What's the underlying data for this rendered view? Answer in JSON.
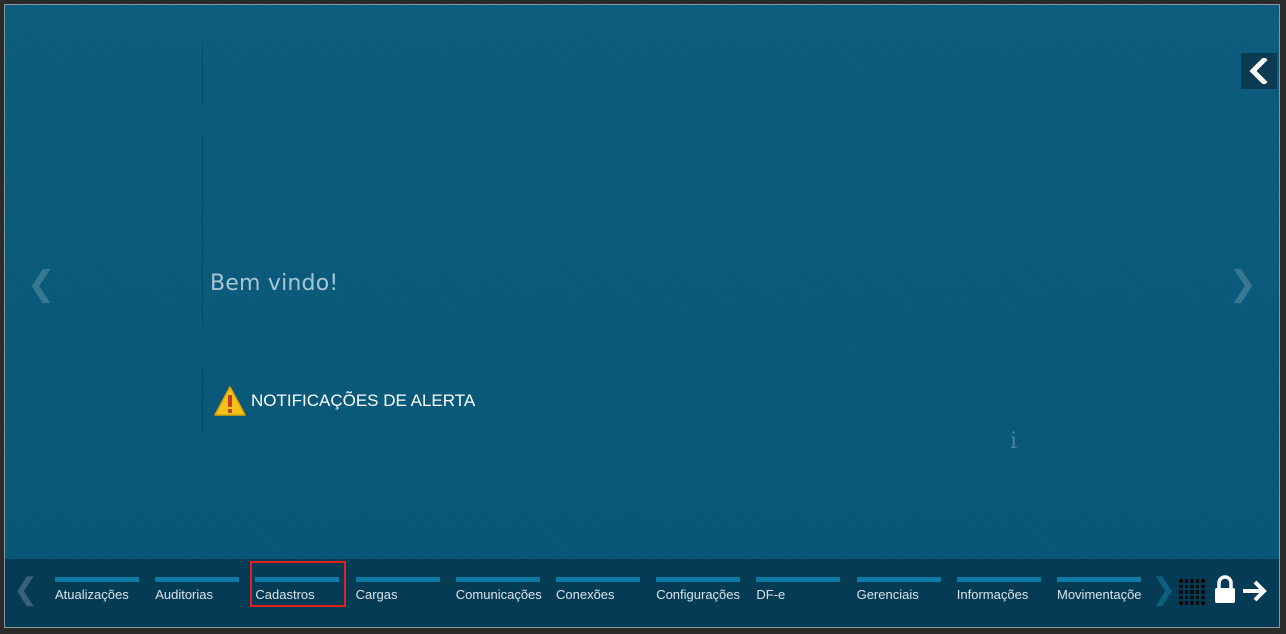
{
  "main": {
    "welcome_text": "Bem vindo!",
    "alerts_label": "NOTIFICAÇÕES DE ALERTA",
    "info_mark": "i"
  },
  "navigation": {
    "prev_glyph": "❮",
    "next_glyph": "❯",
    "collapse_icon": "chevron-left-icon"
  },
  "taskbar": {
    "tabs": [
      {
        "label": "Atualizações"
      },
      {
        "label": "Auditorias"
      },
      {
        "label": "Cadastros"
      },
      {
        "label": "Cargas"
      },
      {
        "label": "Comunicações"
      },
      {
        "label": "Conexões"
      },
      {
        "label": "Configurações"
      },
      {
        "label": "DF-e"
      },
      {
        "label": "Gerenciais"
      },
      {
        "label": "Informações"
      },
      {
        "label": "Movimentações"
      }
    ],
    "highlighted_tab": "Cadastros",
    "icons": [
      "apps-grid-icon",
      "lock-icon",
      "logout-arrow-icon"
    ]
  },
  "colors": {
    "background": "#0b5a7c",
    "taskbar": "#063b55",
    "tab_bar": "#0f7aa3",
    "highlight": "#e02020"
  }
}
